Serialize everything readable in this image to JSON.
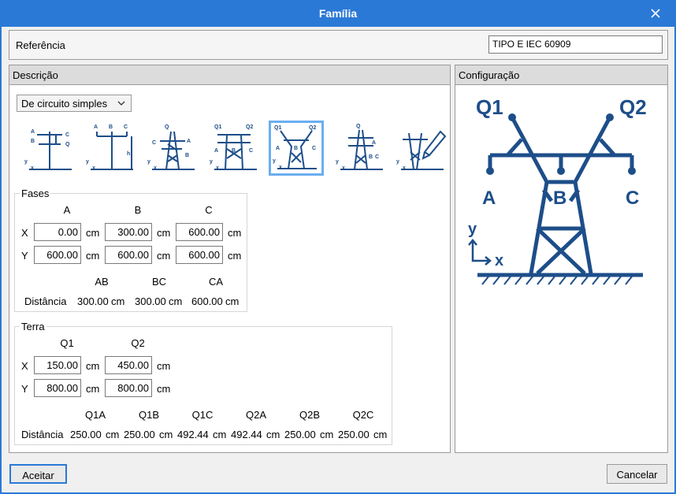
{
  "window": {
    "title": "Família"
  },
  "reference": {
    "label": "Referência",
    "value": "TIPO E IEC 60909"
  },
  "description": {
    "title": "Descrição",
    "circuit_select": {
      "value": "De circuito simples"
    },
    "types": [
      {
        "name": "type-1"
      },
      {
        "name": "type-2"
      },
      {
        "name": "type-3"
      },
      {
        "name": "type-4"
      },
      {
        "name": "type-5",
        "selected": true
      },
      {
        "name": "type-6"
      },
      {
        "name": "type-custom"
      }
    ],
    "icon_labels": {
      "t1": [
        "A",
        "B",
        "C",
        "Q"
      ],
      "t2": [
        "A",
        "B",
        "C",
        "h"
      ],
      "t3": [
        "Q",
        "C",
        "A",
        "B"
      ],
      "t4": [
        "Q1",
        "Q2",
        "A",
        "B",
        "C"
      ],
      "t5": [
        "Q1",
        "Q2",
        "A",
        "B",
        "C"
      ],
      "t6": [
        "Q",
        "A",
        "B",
        "C"
      ],
      "axes": [
        "y",
        "x"
      ]
    }
  },
  "fases": {
    "legend": "Fases",
    "columns": [
      "A",
      "B",
      "C"
    ],
    "rows": [
      {
        "label": "X",
        "values": [
          "0.00",
          "300.00",
          "600.00"
        ]
      },
      {
        "label": "Y",
        "values": [
          "600.00",
          "600.00",
          "600.00"
        ]
      }
    ],
    "unit": "cm",
    "dist_columns": [
      "AB",
      "BC",
      "CA"
    ],
    "dist_label": "Distância",
    "distances": [
      "300.00",
      "300.00",
      "600.00"
    ]
  },
  "terra": {
    "legend": "Terra",
    "columns": [
      "Q1",
      "Q2"
    ],
    "rows": [
      {
        "label": "X",
        "values": [
          "150.00",
          "450.00"
        ]
      },
      {
        "label": "Y",
        "values": [
          "800.00",
          "800.00"
        ]
      }
    ],
    "unit": "cm",
    "dist_columns": [
      "Q1A",
      "Q1B",
      "Q1C",
      "Q2A",
      "Q2B",
      "Q2C"
    ],
    "dist_label": "Distância",
    "distances": [
      "250.00",
      "250.00",
      "492.44",
      "492.44",
      "250.00",
      "250.00"
    ]
  },
  "configuration": {
    "title": "Configuração",
    "labels": {
      "q1": "Q1",
      "q2": "Q2",
      "a": "A",
      "b": "B",
      "c": "C",
      "y": "y",
      "x": "x"
    }
  },
  "buttons": {
    "accept": "Aceitar",
    "cancel": "Cancelar"
  },
  "colors": {
    "titlebar": "#2b79d6",
    "tower": "#1d4e89",
    "selected": "#6aaef0"
  }
}
